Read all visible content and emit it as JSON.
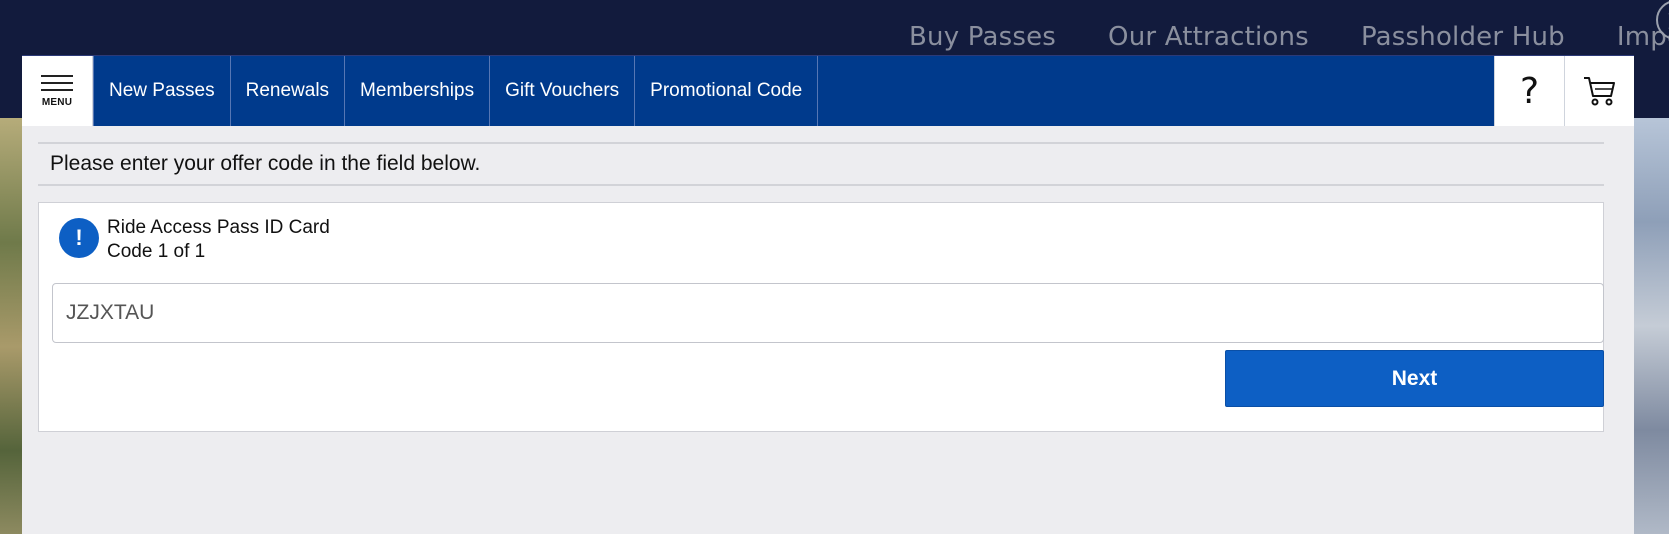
{
  "background": {
    "nav_links": [
      "Buy Passes",
      "Our Attractions",
      "Passholder Hub",
      "Impor"
    ]
  },
  "header": {
    "menu_label": "MENU",
    "tabs": [
      {
        "label": "New Passes"
      },
      {
        "label": "Renewals"
      },
      {
        "label": "Memberships"
      },
      {
        "label": "Gift Vouchers"
      },
      {
        "label": "Promotional Code"
      }
    ],
    "help_icon": "?",
    "cart_icon": "cart-icon"
  },
  "main": {
    "instruction": "Please enter your offer code in the field below.",
    "pass": {
      "name": "Ride Access Pass ID Card",
      "code_progress": "Code 1 of 1",
      "alert_icon": "!"
    },
    "code_input": {
      "value": "JZJXTAU",
      "placeholder": ""
    },
    "next_label": "Next"
  },
  "colors": {
    "nav_blue": "#003a8c",
    "button_blue": "#0d5fc4",
    "page_bg": "#121b3d"
  }
}
